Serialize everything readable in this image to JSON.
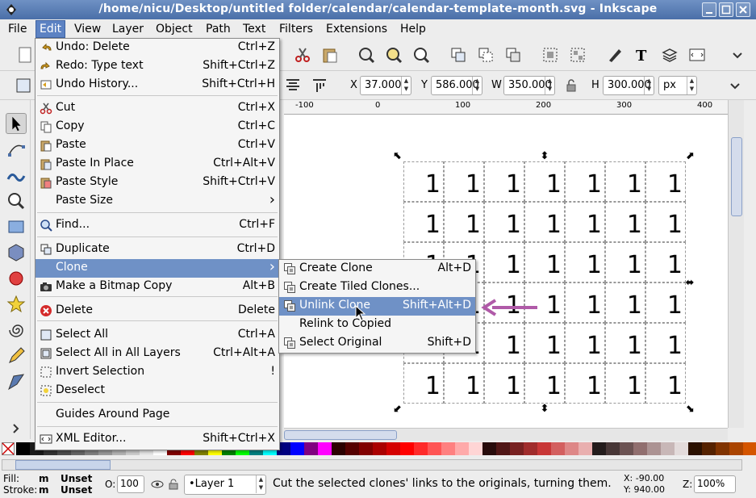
{
  "window": {
    "title": "/home/nicu/Desktop/untitled folder/calendar/calendar-template-month.svg - Inkscape"
  },
  "menubar": {
    "items": [
      "File",
      "Edit",
      "View",
      "Layer",
      "Object",
      "Path",
      "Text",
      "Filters",
      "Extensions",
      "Help"
    ],
    "active": "Edit"
  },
  "toolbar2": {
    "x_label": "X",
    "x_value": "37.000",
    "y_label": "Y",
    "y_value": "586.000",
    "w_label": "W",
    "w_value": "350.000",
    "h_label": "H",
    "h_value": "300.000",
    "unit": "px"
  },
  "ruler": {
    "ticks": [
      "-100",
      "0",
      "100",
      "200",
      "300",
      "400"
    ]
  },
  "canvas": {
    "cell_text": "1",
    "rows": 6,
    "cols": 7
  },
  "edit_menu": {
    "items": [
      {
        "label": "Undo: Delete",
        "accel": "Ctrl+Z",
        "icon": "undo-icon"
      },
      {
        "label": "Redo: Type text",
        "accel": "Shift+Ctrl+Z",
        "icon": "redo-icon"
      },
      {
        "label": "Undo History...",
        "accel": "Shift+Ctrl+H",
        "icon": "undo-history-icon"
      },
      {
        "label": "Cut",
        "accel": "Ctrl+X",
        "icon": "cut-icon"
      },
      {
        "label": "Copy",
        "accel": "Ctrl+C",
        "icon": "copy-icon"
      },
      {
        "label": "Paste",
        "accel": "Ctrl+V",
        "icon": "paste-icon"
      },
      {
        "label": "Paste In Place",
        "accel": "Ctrl+Alt+V",
        "icon": "paste-in-place-icon"
      },
      {
        "label": "Paste Style",
        "accel": "Shift+Ctrl+V",
        "icon": "paste-style-icon"
      },
      {
        "label": "Paste Size",
        "accel": "",
        "icon": ""
      },
      {
        "label": "Find...",
        "accel": "Ctrl+F",
        "icon": "find-icon"
      },
      {
        "label": "Duplicate",
        "accel": "Ctrl+D",
        "icon": "duplicate-icon"
      },
      {
        "label": "Clone",
        "accel": "",
        "icon": ""
      },
      {
        "label": "Make a Bitmap Copy",
        "accel": "Alt+B",
        "icon": "bitmap-copy-icon"
      },
      {
        "label": "Delete",
        "accel": "Delete",
        "icon": "delete-icon"
      },
      {
        "label": "Select All",
        "accel": "Ctrl+A",
        "icon": "select-all-icon"
      },
      {
        "label": "Select All in All Layers",
        "accel": "Ctrl+Alt+A",
        "icon": "select-all-layers-icon"
      },
      {
        "label": "Invert Selection",
        "accel": "!",
        "icon": "invert-selection-icon"
      },
      {
        "label": "Deselect",
        "accel": "",
        "icon": "deselect-icon"
      },
      {
        "label": "Guides Around Page",
        "accel": "",
        "icon": ""
      },
      {
        "label": "XML Editor...",
        "accel": "Shift+Ctrl+X",
        "icon": "xml-editor-icon"
      }
    ]
  },
  "clone_submenu": {
    "items": [
      {
        "label": "Create Clone",
        "accel": "Alt+D"
      },
      {
        "label": "Create Tiled Clones...",
        "accel": ""
      },
      {
        "label": "Unlink Clone",
        "accel": "Shift+Alt+D"
      },
      {
        "label": "Relink to Copied",
        "accel": ""
      },
      {
        "label": "Select Original",
        "accel": "Shift+D"
      }
    ],
    "highlighted": "Unlink Clone"
  },
  "statusbar": {
    "fill_label": "Fill:",
    "fill_m": "m",
    "fill_value": "Unset",
    "stroke_label": "Stroke:",
    "stroke_m": "m",
    "stroke_value": "Unset",
    "opacity_label": "O:",
    "opacity_value": "100",
    "layer": "•Layer 1",
    "message": "Cut the selected clones' links to the originals, turning them.",
    "x_readout": "X: -90.00",
    "y_readout": "Y: 940.00",
    "zoom_label": "Z:",
    "zoom_value": "100%"
  },
  "colors": {
    "highlight": "#6f91c6",
    "annotation_arrow": "#b05aa8"
  }
}
